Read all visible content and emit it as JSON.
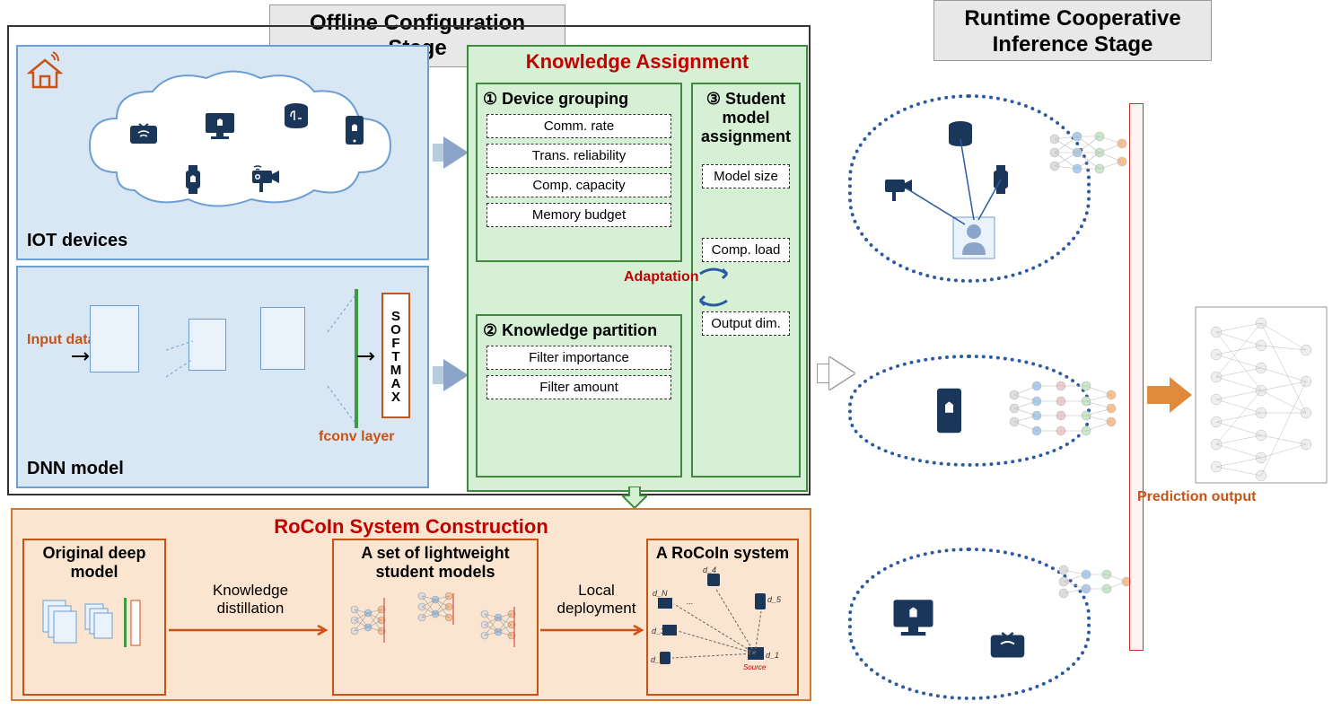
{
  "headers": {
    "offline": "Offline Configuration Stage",
    "runtime": "Runtime Cooperative Inference Stage"
  },
  "iot": {
    "label": "IOT devices"
  },
  "dnn": {
    "label": "DNN model",
    "input": "Input data",
    "fconv": "fconv layer",
    "softmax": "SOFTMAX"
  },
  "knowledge": {
    "title": "Knowledge Assignment",
    "adaptation": "Adaptation",
    "grouping": {
      "title": "① Device grouping",
      "items": [
        "Comm. rate",
        "Trans. reliability",
        "Comp. capacity",
        "Memory budget"
      ]
    },
    "partition": {
      "title": "② Knowledge partition",
      "items": [
        "Filter importance",
        "Filter amount"
      ]
    },
    "student": {
      "title": "③ Student model assignment",
      "items": [
        "Model size",
        "Comp. load",
        "Output dim."
      ]
    }
  },
  "rocoin": {
    "title": "RoCoIn System Construction",
    "box1": "Original deep model",
    "box2": "A set of lightweight student models",
    "box3": "A RoCoIn system",
    "kd": "Knowledge distillation",
    "ld": "Local deployment"
  },
  "runtime": {
    "prediction": "Prediction output"
  }
}
